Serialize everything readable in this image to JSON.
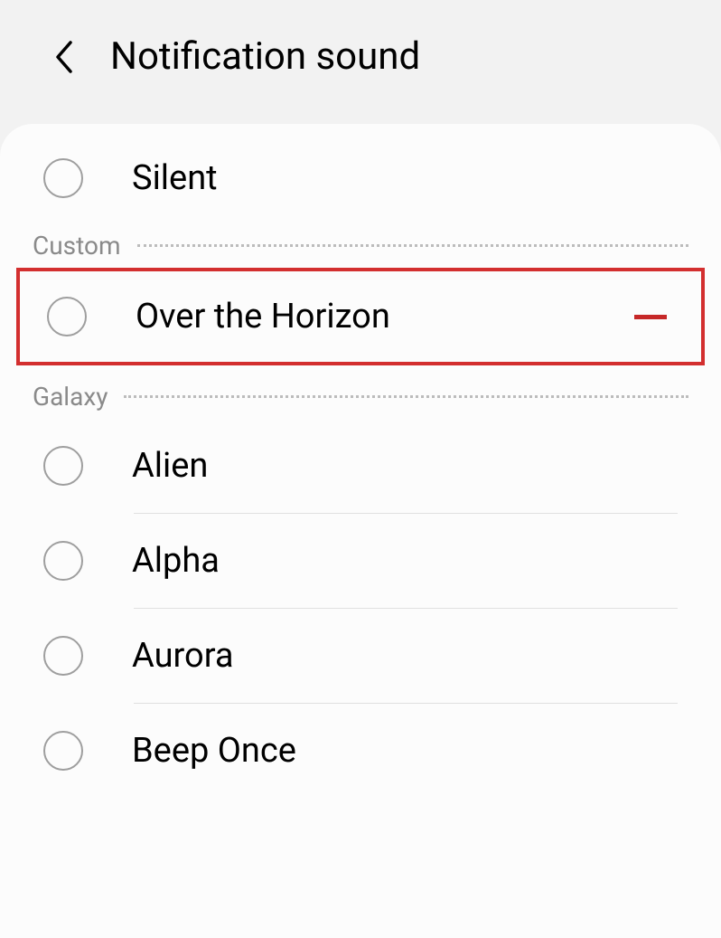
{
  "header": {
    "title": "Notification sound"
  },
  "items": {
    "silent": "Silent"
  },
  "sections": {
    "custom": {
      "label": "Custom",
      "items": [
        "Over the Horizon"
      ]
    },
    "galaxy": {
      "label": "Galaxy",
      "items": [
        "Alien",
        "Alpha",
        "Aurora",
        "Beep Once"
      ]
    }
  }
}
